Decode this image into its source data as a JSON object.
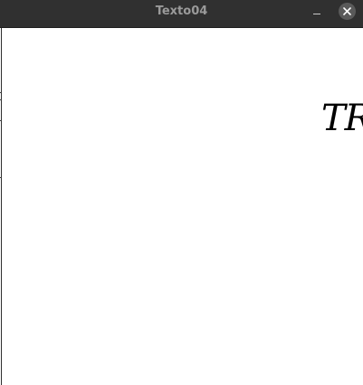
{
  "window": {
    "title": "Texto04"
  },
  "canvas": {
    "text": "TR",
    "text_color": "#000000"
  },
  "colors": {
    "titlebar": "#303030",
    "title_text": "#9a9a9a",
    "close_button": "#5a5a5a",
    "content_background": "#ffffff"
  },
  "icons": {
    "minimize": "minimize-icon",
    "close": "close-icon"
  }
}
